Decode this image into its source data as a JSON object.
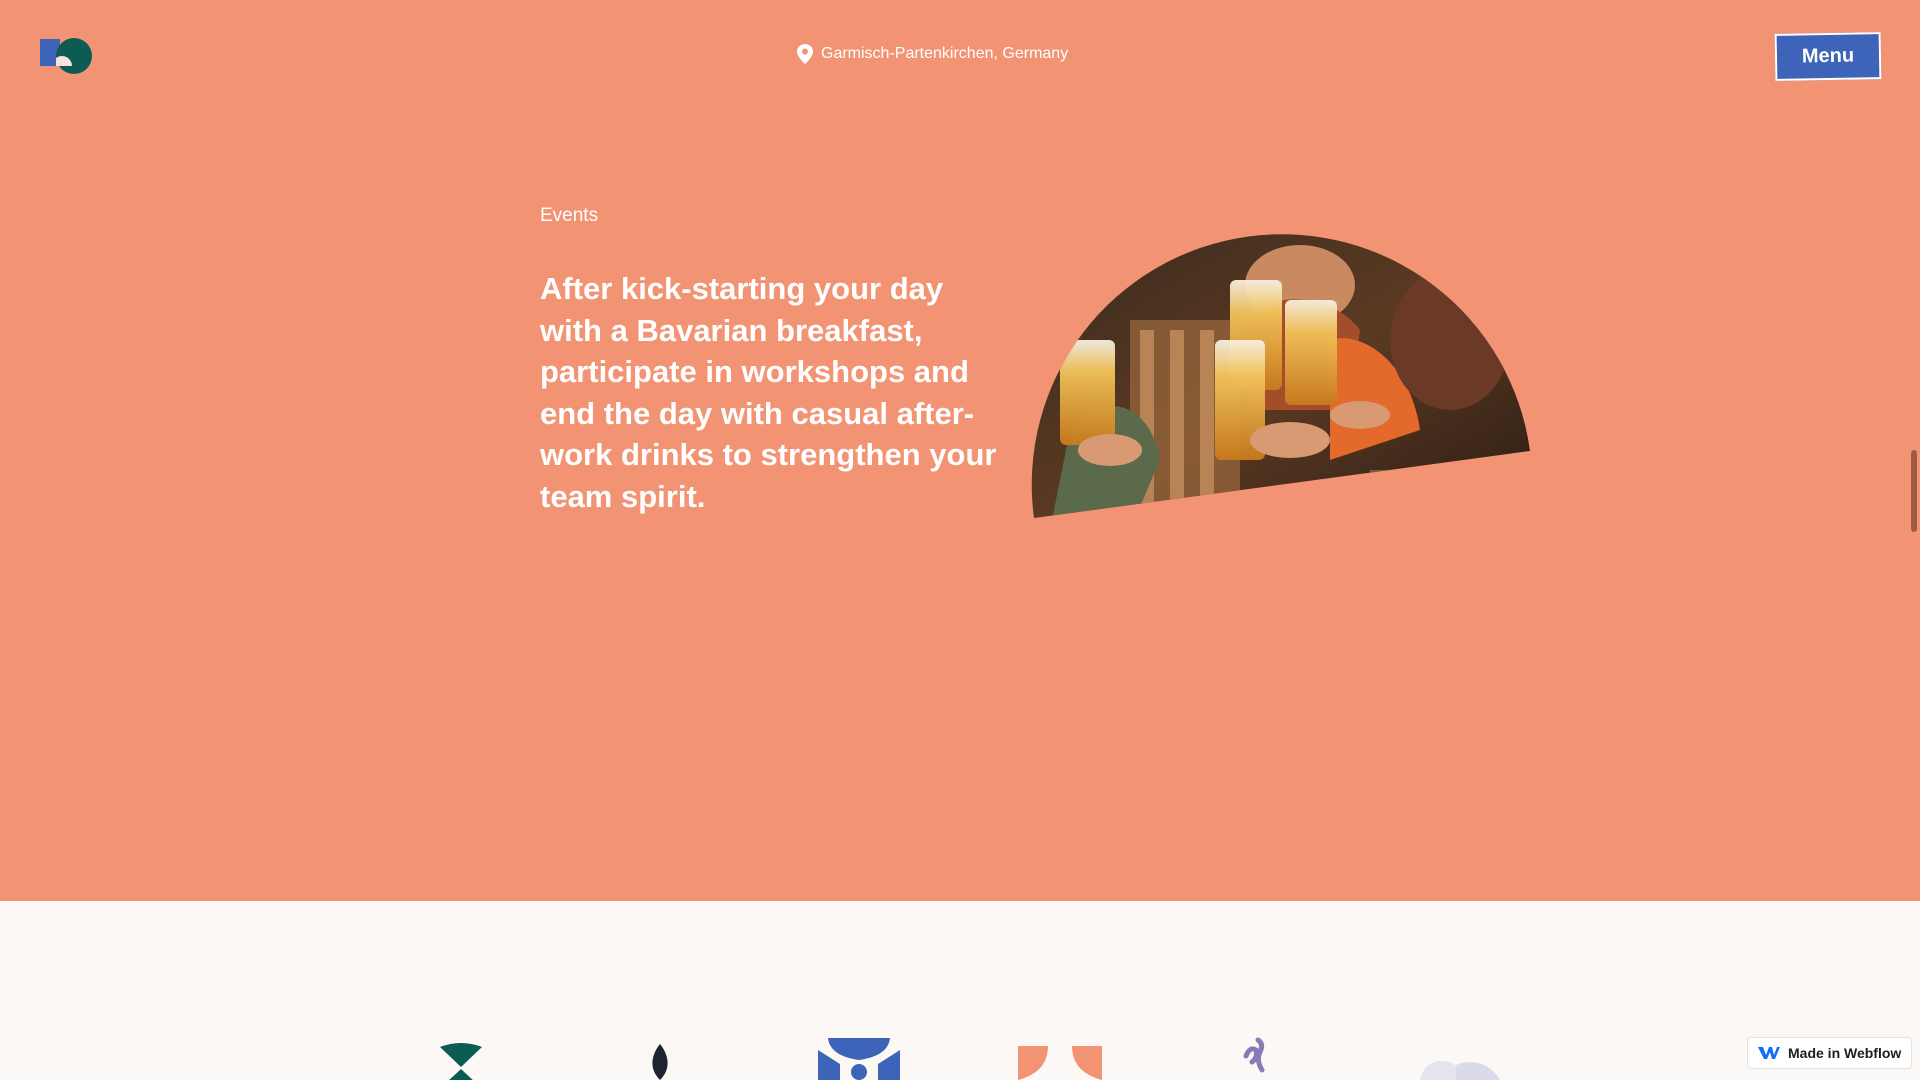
{
  "header": {
    "location": "Garmisch-Partenkirchen, Germany",
    "menu_label": "Menu"
  },
  "hero": {
    "section_label": "Events",
    "headline": "After kick-starting your day with a Bavarian breakfast, participate in workshops and end the day with casual after-work drinks to strengthen your team spirit."
  },
  "badge": {
    "label": "Made in Webflow"
  },
  "colors": {
    "hero_bg": "#f29474",
    "accent_blue": "#3d64b8",
    "dark_green": "#0d5c54",
    "lower_bg": "#fbf8f6"
  },
  "icons": [
    "logo-icon",
    "location-pin-icon",
    "webflow-icon"
  ]
}
